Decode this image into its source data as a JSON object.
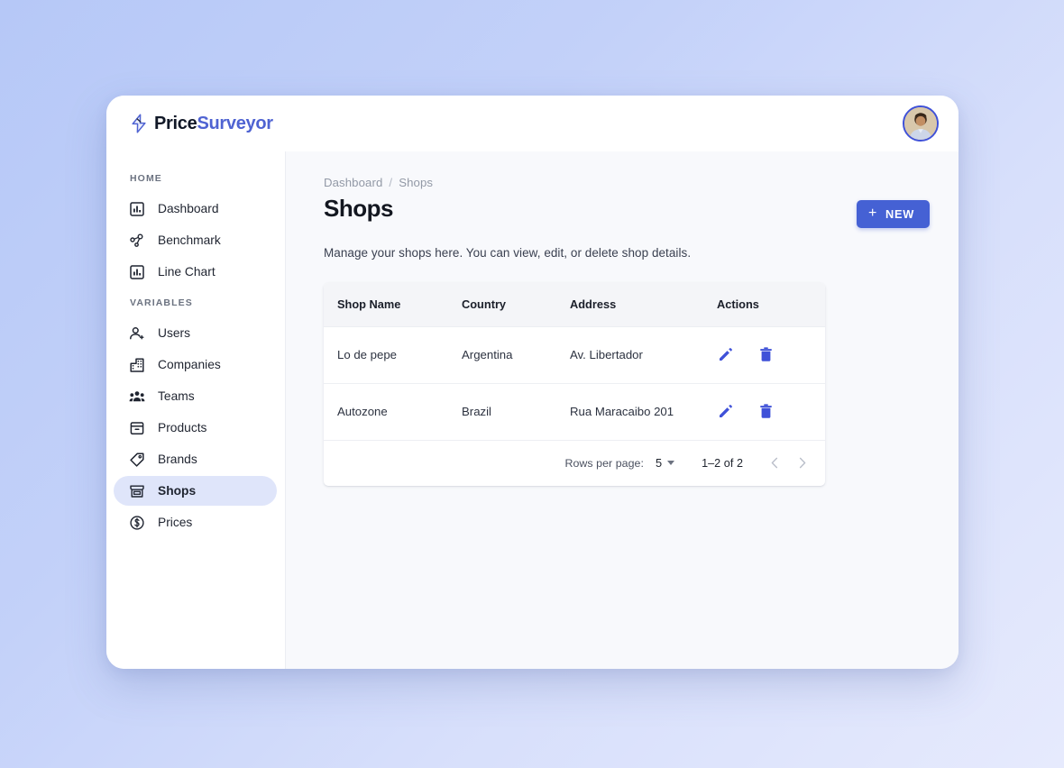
{
  "brand": {
    "name_part_1": "Price",
    "name_part_2": "Surveyor",
    "icon": "lightning-bolt-icon"
  },
  "topbar": {
    "avatar_icon": "user-avatar"
  },
  "sidebar": {
    "sections": [
      {
        "label": "HOME",
        "items": [
          {
            "label": "Dashboard",
            "icon": "bar-chart-icon",
            "active": false
          },
          {
            "label": "Benchmark",
            "icon": "hub-network-icon",
            "active": false
          },
          {
            "label": "Line Chart",
            "icon": "bar-chart-icon",
            "active": false
          }
        ]
      },
      {
        "label": "VARIABLES",
        "items": [
          {
            "label": "Users",
            "icon": "person-add-icon",
            "active": false
          },
          {
            "label": "Companies",
            "icon": "apartment-icon",
            "active": false
          },
          {
            "label": "Teams",
            "icon": "groups-icon",
            "active": false
          },
          {
            "label": "Products",
            "icon": "inventory-icon",
            "active": false
          },
          {
            "label": "Brands",
            "icon": "tag-icon",
            "active": false
          },
          {
            "label": "Shops",
            "icon": "storefront-icon",
            "active": true
          },
          {
            "label": "Prices",
            "icon": "dollar-circle-icon",
            "active": false
          }
        ]
      }
    ]
  },
  "main": {
    "breadcrumb": {
      "parent": "Dashboard",
      "separator": "/",
      "current": "Shops"
    },
    "page_title": "Shops",
    "new_button": {
      "label": "NEW",
      "plus_glyph": "+"
    },
    "description": "Manage your shops here. You can view, edit, or delete shop details.",
    "table": {
      "columns": [
        "Shop Name",
        "Country",
        "Address",
        "Actions"
      ],
      "rows": [
        {
          "shop_name": "Lo de pepe",
          "country": "Argentina",
          "address": "Av. Libertador",
          "edit_icon": "pencil-icon",
          "delete_icon": "trash-icon"
        },
        {
          "shop_name": "Autozone",
          "country": "Brazil",
          "address": "Rua Maracaibo 201",
          "edit_icon": "pencil-icon",
          "delete_icon": "trash-icon"
        }
      ],
      "pagination": {
        "rows_per_page_label": "Rows per page:",
        "rows_per_page_value": "5",
        "range_label": "1–2 of 2",
        "prev_icon": "chevron-left-icon",
        "next_icon": "chevron-right-icon"
      }
    }
  },
  "colors": {
    "accent": "#4561d4",
    "brand_blue": "#4f63d2",
    "active_pill": "#dfe5fa",
    "page_bg_start": "#b6c8f7",
    "page_bg_end": "#e6eafd",
    "table_header_bg": "#f4f5f8",
    "main_bg": "#f8f9fc"
  }
}
